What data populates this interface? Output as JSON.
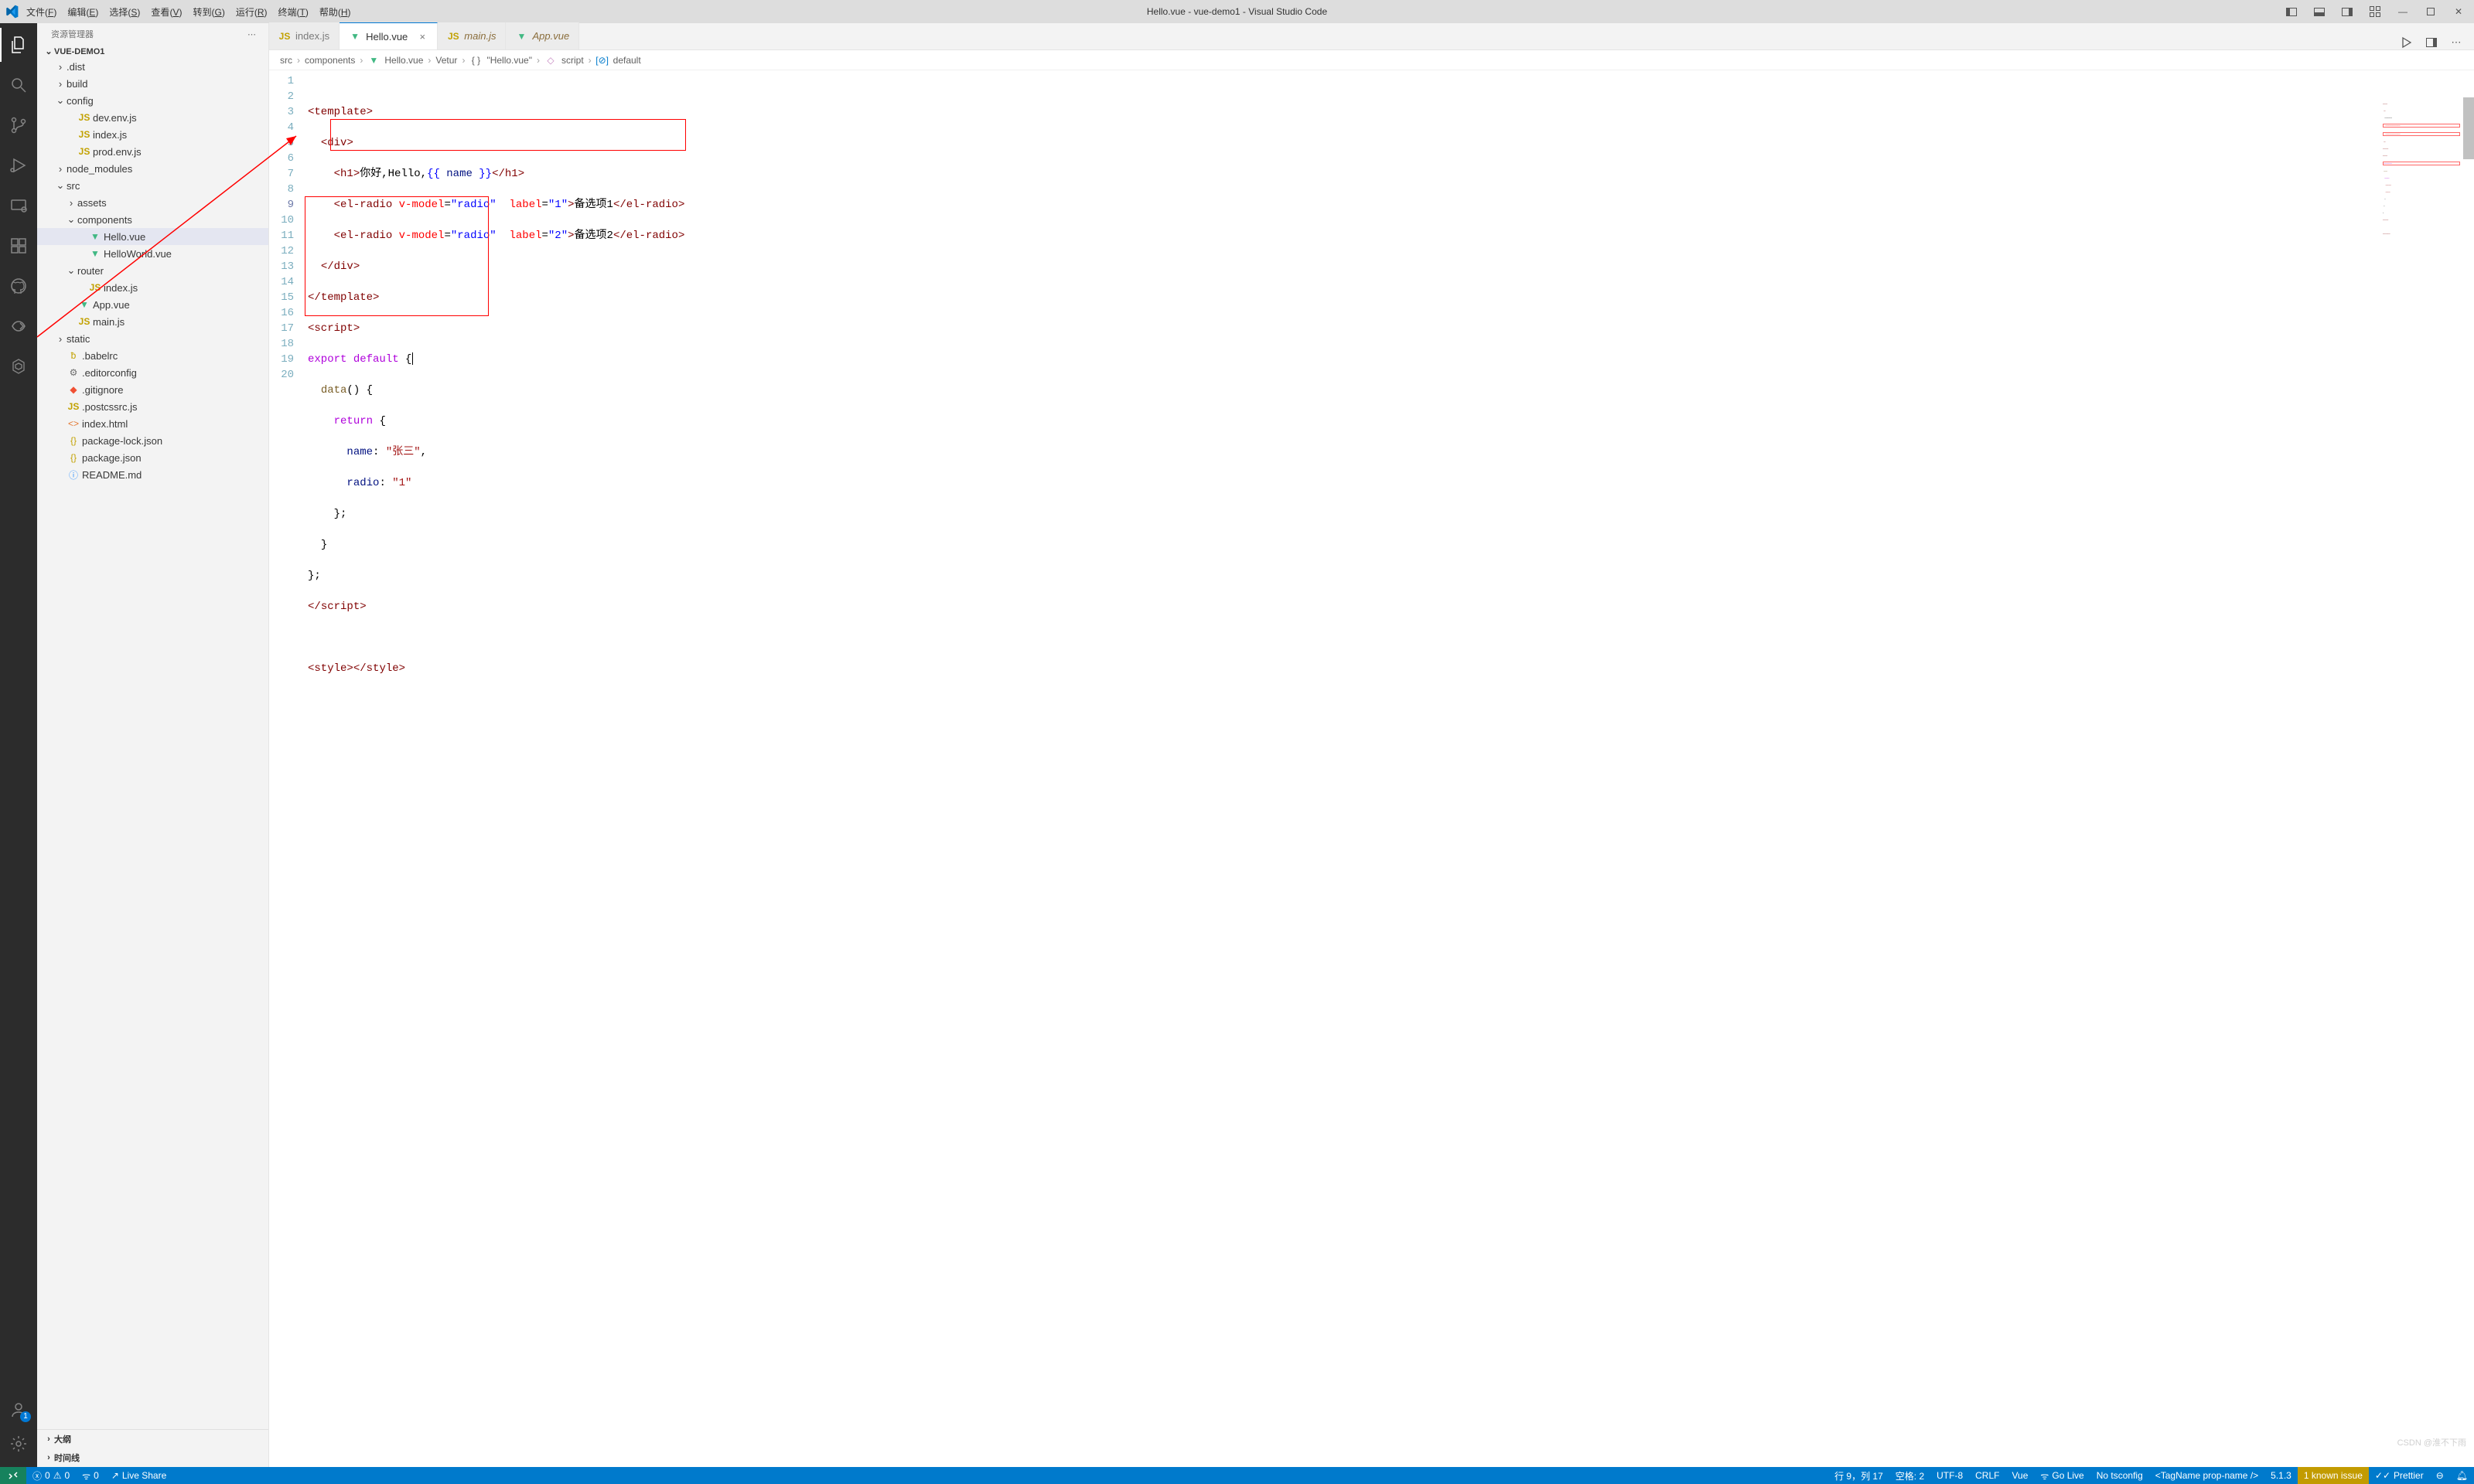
{
  "window_title": "Hello.vue - vue-demo1 - Visual Studio Code",
  "menu": [
    {
      "label": "文件",
      "hot": "F"
    },
    {
      "label": "编辑",
      "hot": "E"
    },
    {
      "label": "选择",
      "hot": "S"
    },
    {
      "label": "查看",
      "hot": "V"
    },
    {
      "label": "转到",
      "hot": "G"
    },
    {
      "label": "运行",
      "hot": "R"
    },
    {
      "label": "终端",
      "hot": "T"
    },
    {
      "label": "帮助",
      "hot": "H"
    }
  ],
  "explorer_title": "资源管理器",
  "project_name": "VUE-DEMO1",
  "activity_badge": "1",
  "tabs": [
    {
      "name": "index.js",
      "icon": "js",
      "active": false,
      "dirty": false,
      "italic": false
    },
    {
      "name": "Hello.vue",
      "icon": "vue",
      "active": true,
      "dirty": false,
      "italic": false
    },
    {
      "name": "main.js",
      "icon": "js",
      "active": false,
      "dirty": false,
      "italic": true
    },
    {
      "name": "App.vue",
      "icon": "vue",
      "active": false,
      "dirty": false,
      "italic": true
    }
  ],
  "breadcrumb": {
    "parts": [
      "src",
      "components",
      "Hello.vue",
      "Vetur",
      "\"Hello.vue\"",
      "script",
      "default"
    ]
  },
  "tree": [
    {
      "type": "folder",
      "name": ".dist",
      "level": 1,
      "open": false
    },
    {
      "type": "folder",
      "name": "build",
      "level": 1,
      "open": false
    },
    {
      "type": "folder",
      "name": "config",
      "level": 1,
      "open": true
    },
    {
      "type": "file",
      "name": "dev.env.js",
      "level": 2,
      "icon": "js"
    },
    {
      "type": "file",
      "name": "index.js",
      "level": 2,
      "icon": "js"
    },
    {
      "type": "file",
      "name": "prod.env.js",
      "level": 2,
      "icon": "js"
    },
    {
      "type": "folder",
      "name": "node_modules",
      "level": 1,
      "open": false
    },
    {
      "type": "folder",
      "name": "src",
      "level": 1,
      "open": true
    },
    {
      "type": "folder",
      "name": "assets",
      "level": 2,
      "open": false
    },
    {
      "type": "folder",
      "name": "components",
      "level": 2,
      "open": true
    },
    {
      "type": "file",
      "name": "Hello.vue",
      "level": 3,
      "icon": "vue",
      "selected": true
    },
    {
      "type": "file",
      "name": "HelloWorld.vue",
      "level": 3,
      "icon": "vue"
    },
    {
      "type": "folder",
      "name": "router",
      "level": 2,
      "open": true
    },
    {
      "type": "file",
      "name": "index.js",
      "level": 3,
      "icon": "js"
    },
    {
      "type": "file",
      "name": "App.vue",
      "level": 2,
      "icon": "vue"
    },
    {
      "type": "file",
      "name": "main.js",
      "level": 2,
      "icon": "js"
    },
    {
      "type": "folder",
      "name": "static",
      "level": 1,
      "open": false
    },
    {
      "type": "file",
      "name": ".babelrc",
      "level": 1,
      "icon": "babel"
    },
    {
      "type": "file",
      "name": ".editorconfig",
      "level": 1,
      "icon": "gear"
    },
    {
      "type": "file",
      "name": ".gitignore",
      "level": 1,
      "icon": "git"
    },
    {
      "type": "file",
      "name": ".postcssrc.js",
      "level": 1,
      "icon": "js"
    },
    {
      "type": "file",
      "name": "index.html",
      "level": 1,
      "icon": "html"
    },
    {
      "type": "file",
      "name": "package-lock.json",
      "level": 1,
      "icon": "json"
    },
    {
      "type": "file",
      "name": "package.json",
      "level": 1,
      "icon": "json"
    },
    {
      "type": "file",
      "name": "README.md",
      "level": 1,
      "icon": "info"
    }
  ],
  "outline_sections": {
    "outline": "大纲",
    "timeline": "时间线"
  },
  "code": {
    "template_open": "<template>",
    "div_open": "<div>",
    "h1_1": "<h1>",
    "h1_text": "你好,Hello,",
    "h1_expr_open": "{{ ",
    "h1_expr": "name",
    "h1_expr_close": " }}",
    "h1_2": "</h1>",
    "radio1_a": "<el-radio ",
    "radio_vm": "v-model",
    "radio_eq": "=",
    "radio_vm_v": "\"radio\" ",
    "radio_lab": "label",
    "radio1_lv": "\"1\"",
    "radio1_t": ">备选项1</el-radio>",
    "radio2_lv": "\"2\"",
    "radio2_t": ">备选项2</el-radio>",
    "div_close": "</div>",
    "template_close": "</template>",
    "script_open": "<script>",
    "export": "export ",
    "default": "default ",
    "brace_o": "{",
    "data": "data",
    "paren": "() ",
    "brace_o2": "{",
    "return": "return ",
    "brace_o3": "{",
    "name_k": "name",
    "name_v": "\"张三\"",
    "radio_k": "radio",
    "radio_v": "\"1\"",
    "brace_c": "};",
    "brace_c2": "}",
    "brace_c3": "};",
    "script_close": "</script>",
    "style": "<style></style>"
  },
  "status": {
    "remote": "><",
    "errors": "0",
    "warnings": "0",
    "ports": "0",
    "live_share": "Live Share",
    "cursor": "行 9，列 17",
    "spaces": "空格: 2",
    "encoding": "UTF-8",
    "eol": "CRLF",
    "lang": "Vue",
    "golive": "Go Live",
    "tsconfig": "No tsconfig",
    "tagname": "<TagName prop-name />",
    "version": "5.1.3",
    "issue": "1 known issue",
    "prettier": "Prettier"
  },
  "watermark": "CSDN @淮不下雨"
}
